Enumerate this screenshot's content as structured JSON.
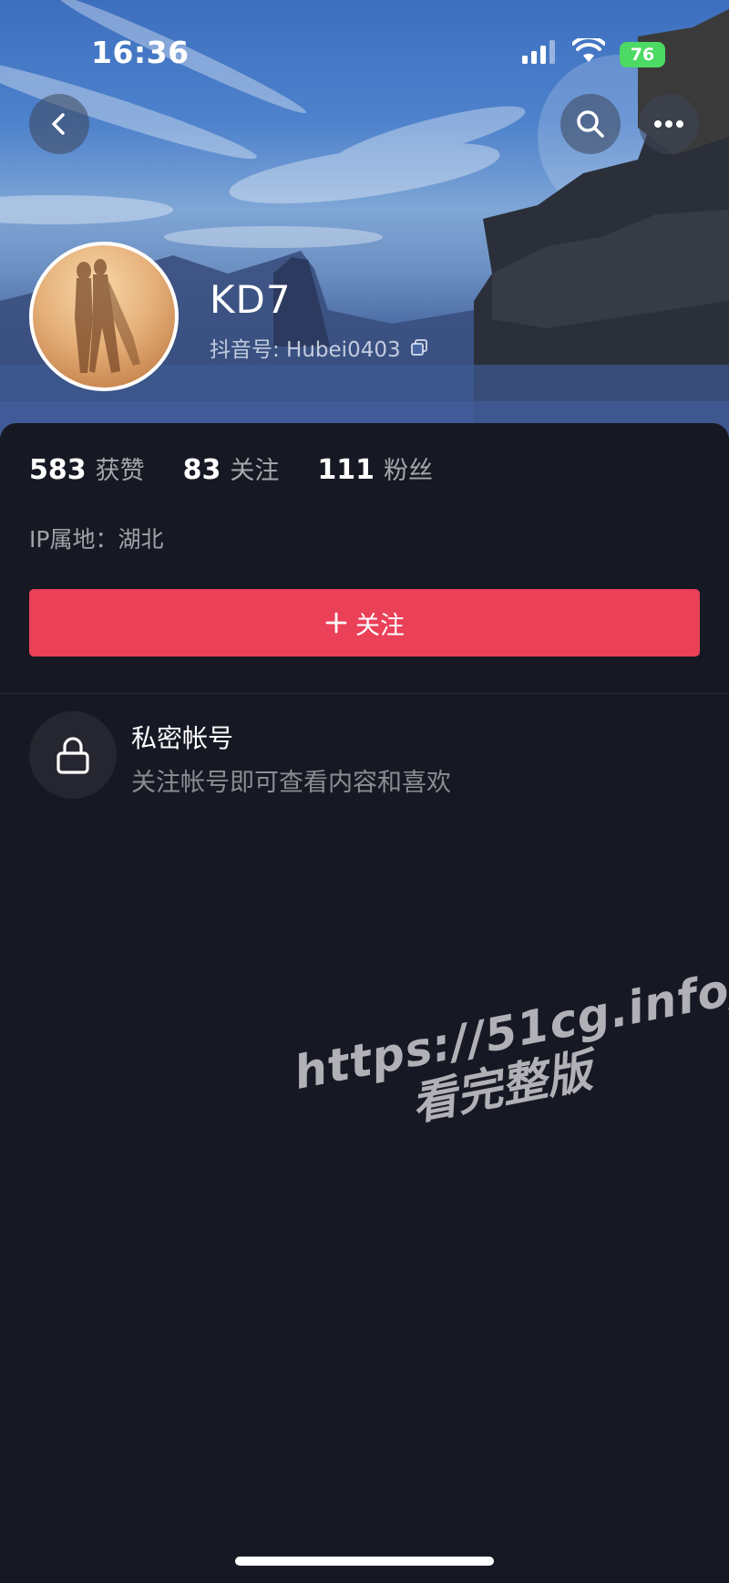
{
  "status_bar": {
    "time": "16:36",
    "battery": "76"
  },
  "header": {
    "back_icon": "chevron-left-icon",
    "search_icon": "search-icon",
    "more_icon": "more-horizontal-icon"
  },
  "profile": {
    "name": "KD7",
    "douyin_id_label": "抖音号: Hubei0403",
    "copy_icon": "copy-icon"
  },
  "stats": [
    {
      "value": "583",
      "label": "获赞"
    },
    {
      "value": "83",
      "label": "关注"
    },
    {
      "value": "111",
      "label": "粉丝"
    }
  ],
  "ip_location": "IP属地：湖北",
  "follow_button": {
    "icon": "plus-icon",
    "label": "关注",
    "color": "#ea4058"
  },
  "private_account": {
    "icon": "lock-icon",
    "title": "私密帐号",
    "subtitle": "关注帐号即可查看内容和喜欢"
  },
  "watermark": {
    "url": "https://51cg.info/",
    "cta": "看完整版"
  },
  "colors": {
    "background": "#161823",
    "accent": "#ea4058",
    "battery": "#4cd964"
  }
}
